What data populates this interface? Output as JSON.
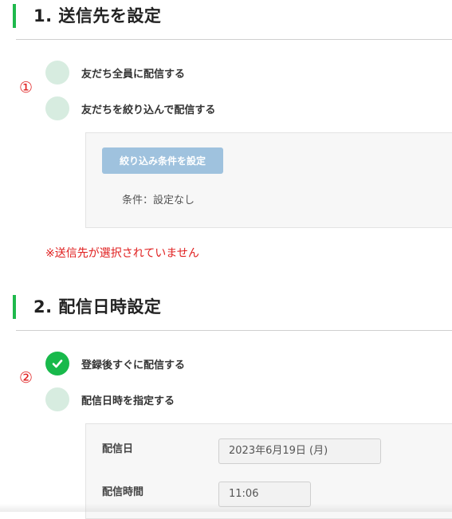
{
  "section1": {
    "title": "1. 送信先を設定",
    "marker": "①",
    "options": [
      {
        "label": "友だち全員に配信する",
        "checked": false
      },
      {
        "label": "友だちを絞り込んで配信する",
        "checked": false
      }
    ],
    "filter_button_label": "絞り込み条件を設定",
    "condition_text": "条件：設定なし",
    "error_text": "※送信先が選択されていません"
  },
  "section2": {
    "title": "2. 配信日時設定",
    "marker": "②",
    "options": [
      {
        "label": "登録後すぐに配信する",
        "checked": true
      },
      {
        "label": "配信日時を指定する",
        "checked": false
      }
    ],
    "date_label": "配信日",
    "date_value": "2023年6月19日 (月)",
    "time_label": "配信時間",
    "time_value": "11:06"
  },
  "colors": {
    "accent_green": "#1fb94c",
    "radio_unchecked": "#d7ece0",
    "error_red": "#e02020",
    "button_disabled": "#9fc2de"
  }
}
